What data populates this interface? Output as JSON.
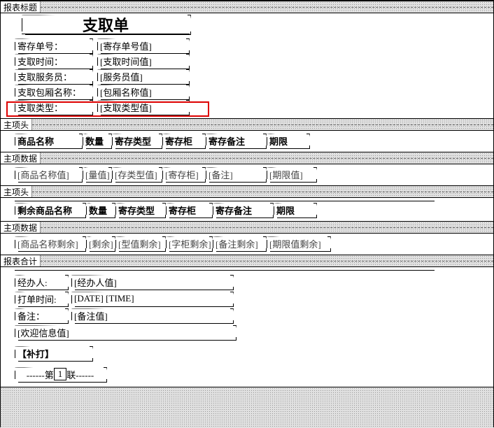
{
  "sections": {
    "title_band": "报表标题",
    "header1": "主项头",
    "detail1": "主项数据",
    "header2": "主项头",
    "detail2": "主项数据",
    "footer": "报表合计"
  },
  "report": {
    "title": "支取单",
    "fields": {
      "deposit_no_lbl": "寄存单号：",
      "deposit_no_val": "[寄存单号值]",
      "withdraw_time_lbl": "支取时间：",
      "withdraw_time_val": "[支取时间值]",
      "staff_lbl": "支取服务员：",
      "staff_val": "[服务员值]",
      "box_lbl": "支取包厢名称：",
      "box_val": "[包厢名称值]",
      "type_lbl": "支取类型：",
      "type_val": "[支取类型值]"
    }
  },
  "table1": {
    "headers": {
      "name": "商品名称",
      "qty": "数量",
      "type": "寄存类型",
      "cabinet": "寄存柜",
      "remark": "寄存备注",
      "limit": "期限"
    },
    "row": {
      "name": "[商品名称值]",
      "qty": "[量值]",
      "type": "[存类型值]",
      "cabinet": "[寄存柜]",
      "remark": "[备注]",
      "limit": "[期限值]"
    }
  },
  "table2": {
    "headers": {
      "name": "剩余商品名称",
      "qty": "数量",
      "type": "寄存类型",
      "cabinet": "寄存柜",
      "remark": "寄存备注",
      "limit": "期限"
    },
    "row": {
      "name": "[商品名称剩余]",
      "qty": "[剩余]",
      "type": "[型值剩余]",
      "cabinet": "[字柜剩余]",
      "remark": "[备注剩余]",
      "limit": "[期限值剩余]"
    }
  },
  "footer": {
    "operator_lbl": "经办人:",
    "operator_val": "[经办人值]",
    "print_time_lbl": "打单时间:",
    "print_time_val": "[DATE] [TIME]",
    "remark_lbl": "备注：",
    "remark_val": "[备注值]",
    "welcome": "[欢迎信息值]",
    "reprint": "【补打】",
    "page_prefix": "------第",
    "page_num": "1",
    "page_suffix": "联------"
  }
}
